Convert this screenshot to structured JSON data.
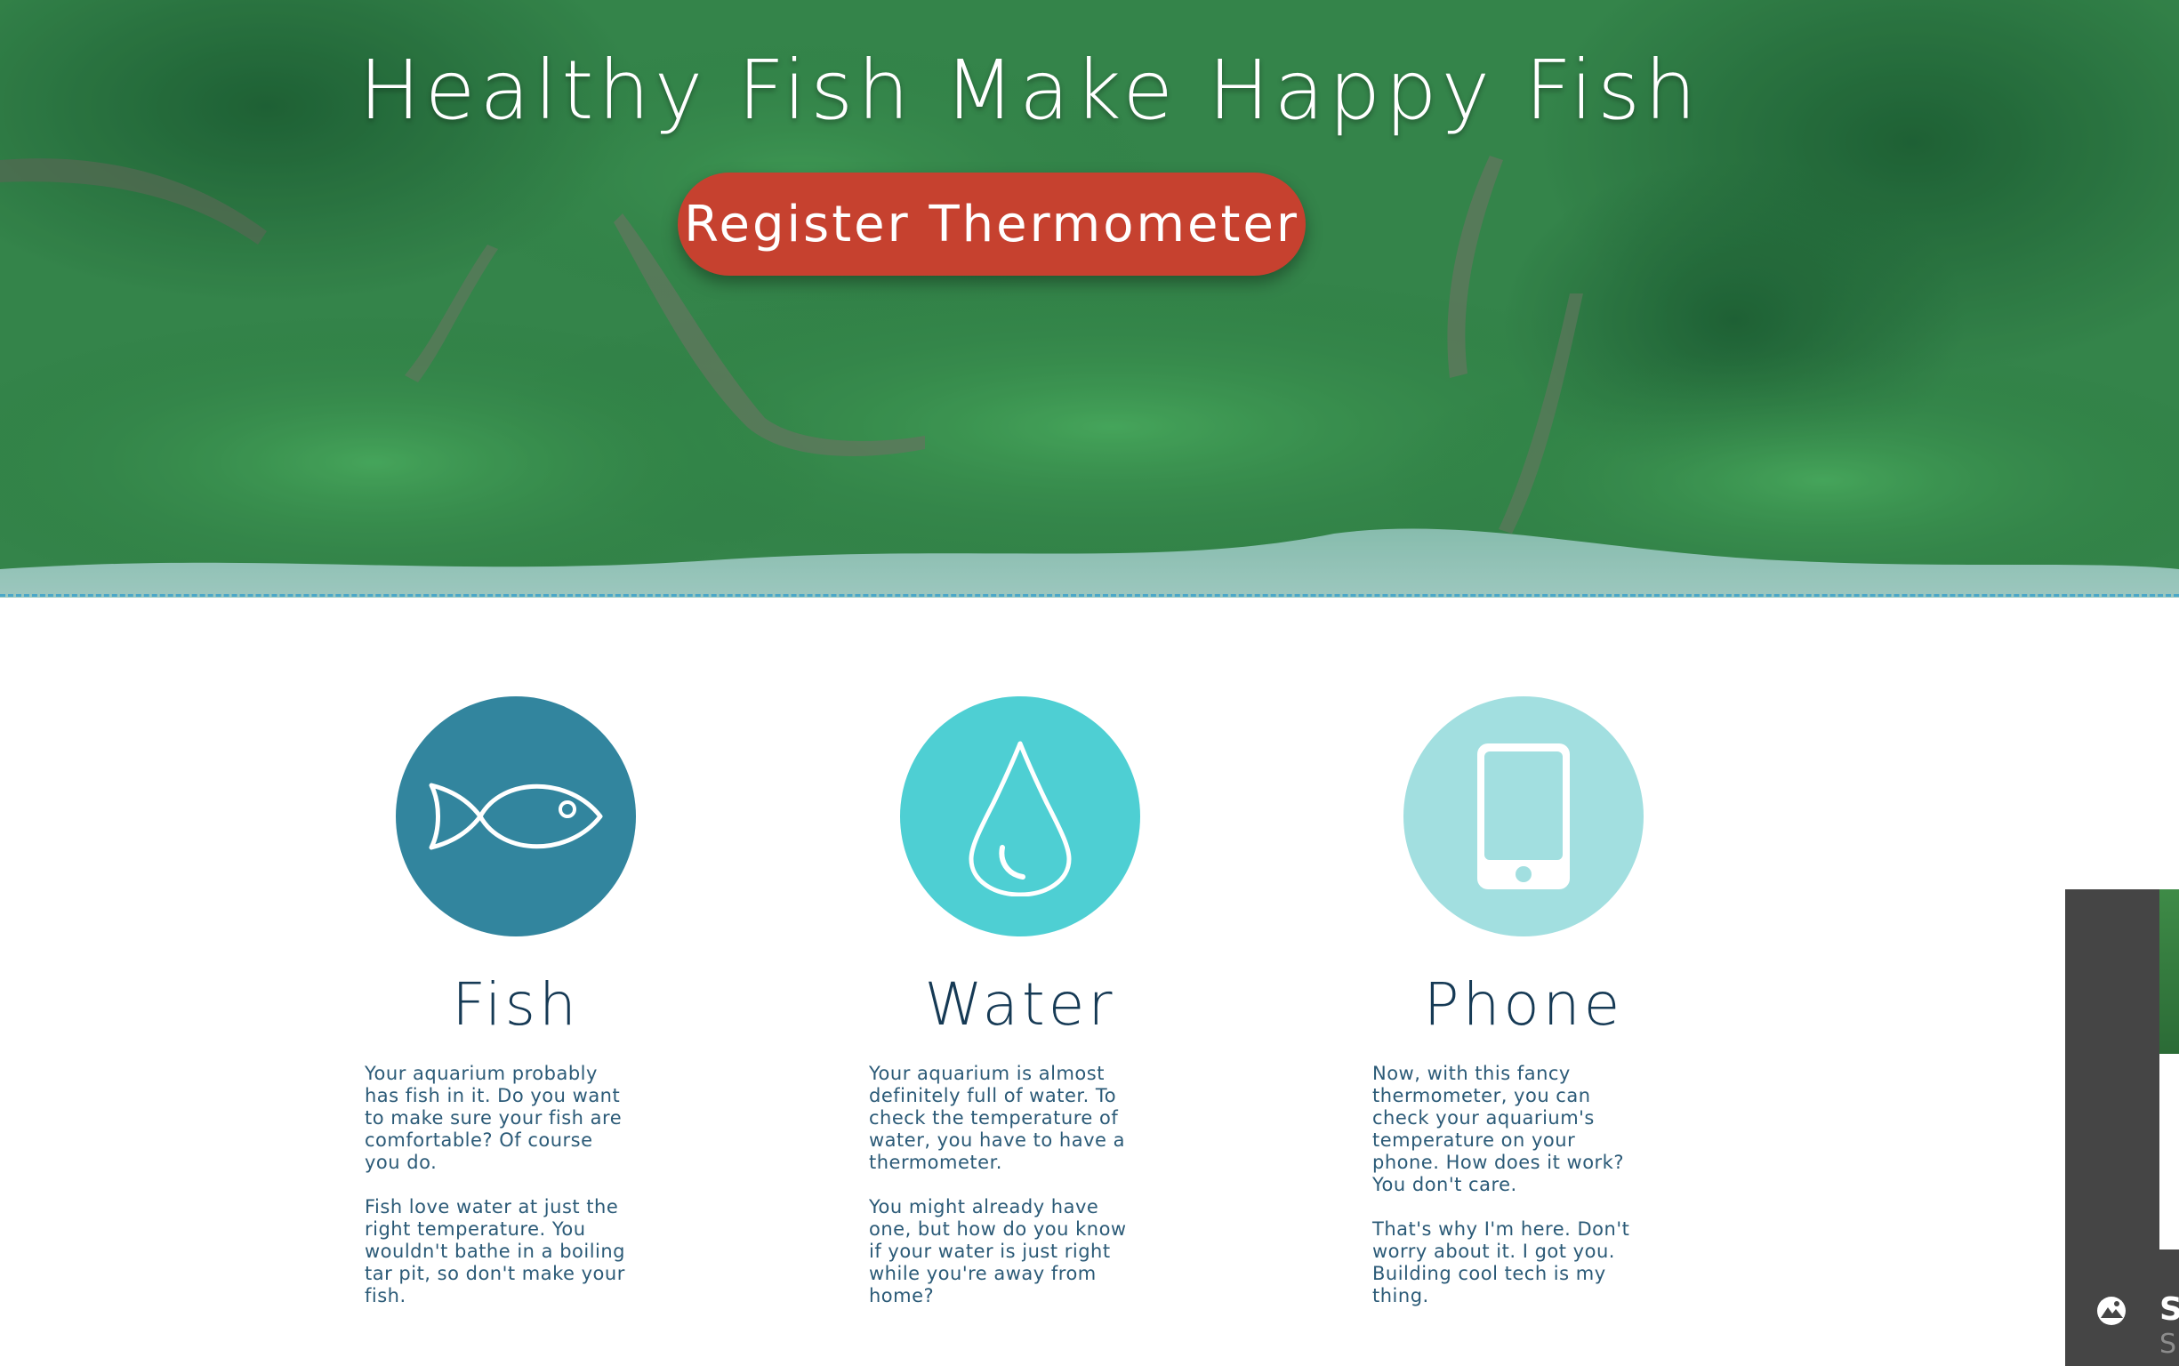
{
  "hero": {
    "title": "Healthy Fish Make Happy Fish",
    "button_label": "Register Thermometer"
  },
  "features": [
    {
      "title": "Fish",
      "icon": "fish-icon",
      "color": "#32859e",
      "paragraphs": [
        "Your aquarium probably has fish in it. Do you want to make sure your fish are comfortable? Of course you do.",
        "Fish love water at just the right temperature. You wouldn't bathe in a boiling tar pit, so don't make your fish."
      ]
    },
    {
      "title": "Water",
      "icon": "water-drop-icon",
      "color": "#4ecfd3",
      "paragraphs": [
        "Your aquarium is almost definitely full of water. To check the temperature of water, you have to have a thermometer.",
        "You might already have one, but how do you know if your water is just right while you're away from home?"
      ]
    },
    {
      "title": "Phone",
      "icon": "phone-icon",
      "color": "#a2dfe0",
      "paragraphs": [
        "Now, with this fancy thermometer, you can check your aquarium's temperature on your phone. How does it work? You don't care.",
        "That's why I'm here. Don't worry about it. I got you. Building cool tech is my thing."
      ]
    }
  ],
  "side_panel": {
    "icon": "mountain-image-icon",
    "label_main": "S",
    "label_sub": "S"
  },
  "colors": {
    "button": "#c6412f",
    "heading": "#163a55",
    "body_text": "#2b5a77",
    "divider": "#4aa7c8"
  }
}
